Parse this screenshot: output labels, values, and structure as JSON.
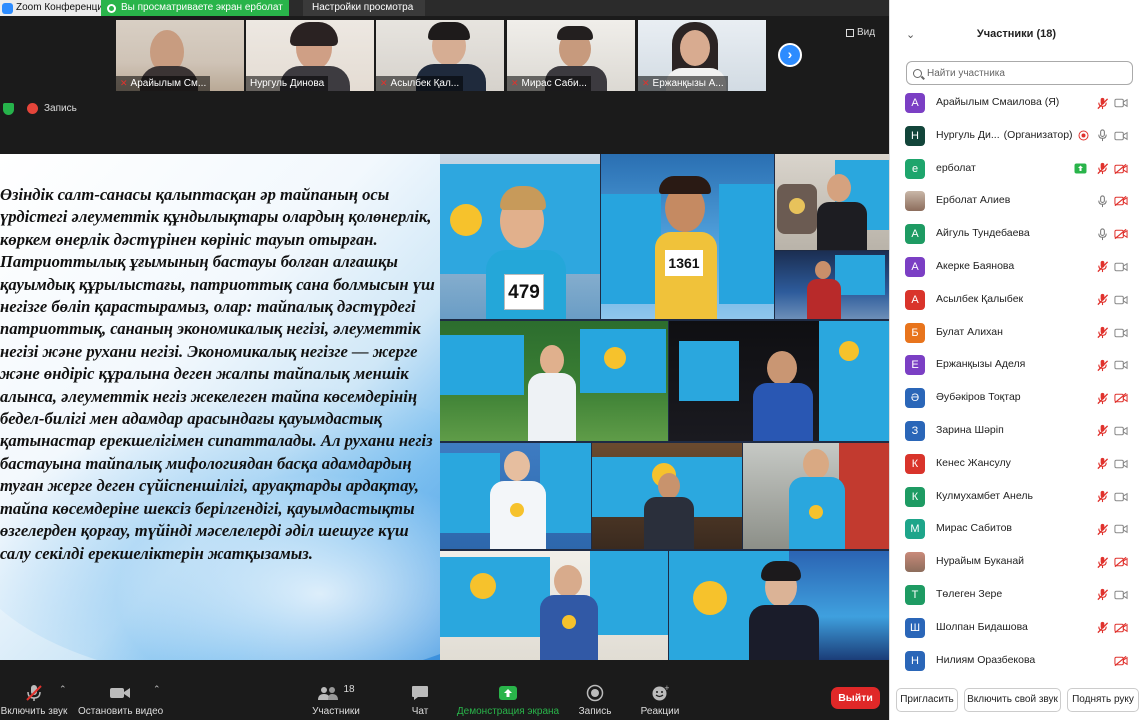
{
  "window": {
    "app_title": "Zoom Конференция"
  },
  "share_banner": {
    "text": "Вы просматриваете экран ерболат"
  },
  "view_options": {
    "label": "Настройки просмотра"
  },
  "view_button": {
    "label": "Вид"
  },
  "record": {
    "label": "Запись"
  },
  "thumbnails": [
    {
      "name": "Арайылым См...",
      "muted": true
    },
    {
      "name": "Нургуль Динова",
      "muted": false
    },
    {
      "name": "Асылбек Қал...",
      "muted": true
    },
    {
      "name": "Мирас Саби...",
      "muted": true
    },
    {
      "name": "Ержанқызы А...",
      "muted": true
    }
  ],
  "slide": {
    "body": "Өзіндік салт-санасы қалыптасқан әр тайпаның осы үрдістегі әлеуметтік құндылықтары олардың қолөнерлік, көркем өнерлік дәстүрінен көрініс тауып отырған. Патриоттылық ұғымының бастауы болған алғашқы қауымдық құрылыстағы, патриоттық сана болмысын үш негізге бөліп қарастырамыз, олар: тайпалық дәстүрдегі патриоттық, сананың экономикалық негізі, әлеуметтік негізі және рухани негізі. Экономикалық негізге — жерге және өндіріс құралына деген жалпы тайпалық меншік алынса, әлеуметтік негіз жекелеген тайпа көсемдерінің бедел-билігі мен адамдар арасындағы қауымдастық қатынастар ерекшелігімен сипатталады. Ал рухани негіз бастауына тайпалық мифологиядан басқа адамдардың туған жерге деген сүйіспеншілігі, аруақтарды ардақтау, тайпа көсемдеріне шексіз берілгендігі, қауымдастықты өзгелерден қорғау, түйінді мәселелерді әділ шешуге күш салу секілді ерекшеліктерін жатқызамыз.",
    "bib_479": "479",
    "bib_1361": "1361"
  },
  "toolbar": {
    "unmute": "Включить звук",
    "start_video": "Остановить видео",
    "participants": "Участники",
    "participants_count": "18",
    "chat": "Чат",
    "share": "Демонстрация экрана",
    "record": "Запись",
    "reactions": "Реакции",
    "leave": "Выйти",
    "colors": {
      "share_green": "#29b44a",
      "leave_red": "#e02828"
    }
  },
  "panel": {
    "title": "Участники (18)",
    "search_placeholder": "Найти участника",
    "participants": [
      {
        "initial": "А",
        "color": "#7b3fc4",
        "name": "Арайылым Смаилова (Я)",
        "role": "",
        "mic": "muted",
        "video": "off",
        "extra": ""
      },
      {
        "initial": "Н",
        "color": "#12453a",
        "name": "Нургуль Ди...",
        "role": "(Организатор)",
        "mic": "on",
        "video": "off",
        "extra": "record"
      },
      {
        "initial": "е",
        "color": "#1ea56c",
        "name": "ерболат",
        "role": "",
        "mic": "muted",
        "video": "off-red",
        "extra": "share"
      },
      {
        "initial": "",
        "color": "#c9b7a8",
        "name": "Ерболат Алиев",
        "role": "",
        "mic": "on",
        "video": "off-red",
        "extra": ""
      },
      {
        "initial": "А",
        "color": "#1e9b63",
        "name": "Айгуль Тундебаева",
        "role": "",
        "mic": "on",
        "video": "off-red",
        "extra": ""
      },
      {
        "initial": "А",
        "color": "#7b3fc4",
        "name": "Акерке Баянова",
        "role": "",
        "mic": "muted",
        "video": "off",
        "extra": ""
      },
      {
        "initial": "А",
        "color": "#d9342b",
        "name": "Асылбек Қалыбек",
        "role": "",
        "mic": "muted",
        "video": "off",
        "extra": ""
      },
      {
        "initial": "Б",
        "color": "#e8741c",
        "name": "Булат Алихан",
        "role": "",
        "mic": "muted",
        "video": "off",
        "extra": ""
      },
      {
        "initial": "Е",
        "color": "#7b3fc4",
        "name": "Ержанқызы Аделя",
        "role": "",
        "mic": "muted",
        "video": "off",
        "extra": ""
      },
      {
        "initial": "Ә",
        "color": "#2a66b8",
        "name": "Әубәкіров Тоқтар",
        "role": "",
        "mic": "muted",
        "video": "off-red",
        "extra": ""
      },
      {
        "initial": "З",
        "color": "#2a66b8",
        "name": "Зарина Шәріп",
        "role": "",
        "mic": "muted",
        "video": "off",
        "extra": ""
      },
      {
        "initial": "К",
        "color": "#d9342b",
        "name": "Кенес Жансулу",
        "role": "",
        "mic": "muted",
        "video": "off",
        "extra": ""
      },
      {
        "initial": "К",
        "color": "#1e9b63",
        "name": "Кулмухамбет Анель",
        "role": "",
        "mic": "muted",
        "video": "off",
        "extra": ""
      },
      {
        "initial": "М",
        "color": "#1ea58a",
        "name": "Мирас Сабитов",
        "role": "",
        "mic": "muted",
        "video": "off",
        "extra": ""
      },
      {
        "initial": "",
        "color": "#c98a7a",
        "name": "Нурайым Буканай",
        "role": "",
        "mic": "muted",
        "video": "off-red",
        "extra": ""
      },
      {
        "initial": "Т",
        "color": "#1e9b63",
        "name": "Төлеген Зере",
        "role": "",
        "mic": "muted",
        "video": "off",
        "extra": ""
      },
      {
        "initial": "Ш",
        "color": "#2a66b8",
        "name": "Шолпан Бидашова",
        "role": "",
        "mic": "muted",
        "video": "off-red",
        "extra": ""
      },
      {
        "initial": "Н",
        "color": "#2a66b8",
        "name": "Нилиям Оразбекова",
        "role": "",
        "mic": "none",
        "video": "off-red",
        "extra": ""
      }
    ],
    "footer": {
      "invite": "Пригласить",
      "unmute_me": "Включить свой звук",
      "raise_hand": "Поднять руку"
    }
  }
}
